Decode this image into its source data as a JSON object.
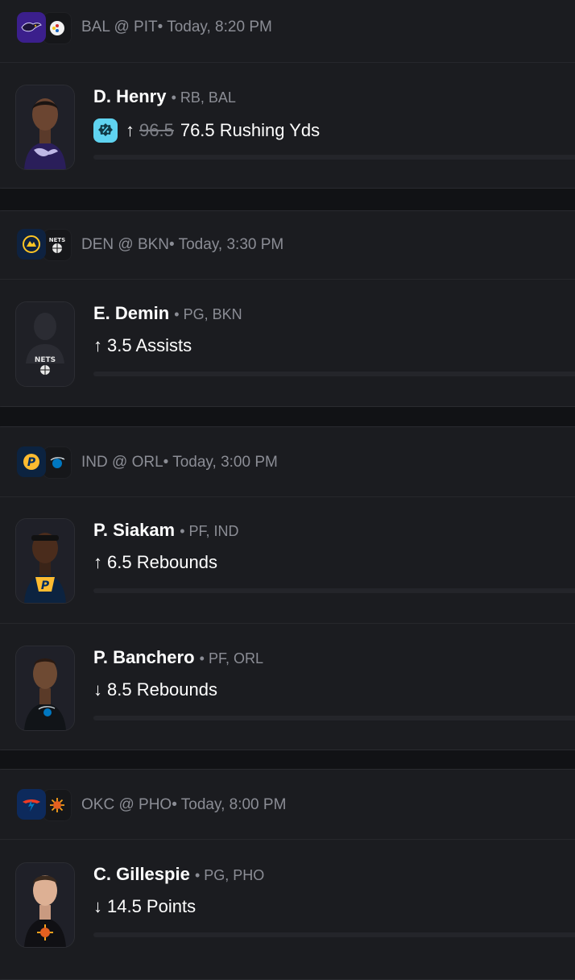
{
  "games": [
    {
      "matchup": "BAL @ PIT",
      "time": "• Today, 8:20 PM",
      "away_logo": "ravens-logo",
      "home_logo": "steelers-logo",
      "props": [
        {
          "name": "D. Henry",
          "meta": "• RB, BAL",
          "direction": "up",
          "arrow": "↑",
          "old_line": "96.5",
          "line": "76.5 Rushing Yds",
          "boosted": true,
          "avatar": "player-photo-henry"
        }
      ]
    },
    {
      "matchup": "DEN @ BKN",
      "time": "• Today, 3:30 PM",
      "away_logo": "nuggets-logo",
      "home_logo": "nets-logo",
      "props": [
        {
          "name": "E. Demin",
          "meta": "• PG, BKN",
          "direction": "up",
          "arrow": "↑",
          "line": "3.5 Assists",
          "boosted": false,
          "avatar": "player-silhouette"
        }
      ]
    },
    {
      "matchup": "IND @ ORL",
      "time": "• Today, 3:00 PM",
      "away_logo": "pacers-logo",
      "home_logo": "magic-logo",
      "props": [
        {
          "name": "P. Siakam",
          "meta": "• PF, IND",
          "direction": "up",
          "arrow": "↑",
          "line": "6.5 Rebounds",
          "boosted": false,
          "avatar": "player-photo-siakam"
        },
        {
          "name": "P. Banchero",
          "meta": "• PF, ORL",
          "direction": "down",
          "arrow": "↓",
          "line": "8.5 Rebounds",
          "boosted": false,
          "avatar": "player-photo-banchero"
        }
      ]
    },
    {
      "matchup": "OKC @ PHO",
      "time": "• Today, 8:00 PM",
      "away_logo": "thunder-logo",
      "home_logo": "suns-logo",
      "props": [
        {
          "name": "C. Gillespie",
          "meta": "• PG, PHO",
          "direction": "down",
          "arrow": "↓",
          "line": "14.5 Points",
          "boosted": false,
          "avatar": "player-photo-gillespie"
        }
      ]
    }
  ],
  "colors": {
    "background": "#111215",
    "card": "#1b1c20",
    "muted_text": "#8b8d95",
    "boost_badge": "#5fd3f0"
  }
}
